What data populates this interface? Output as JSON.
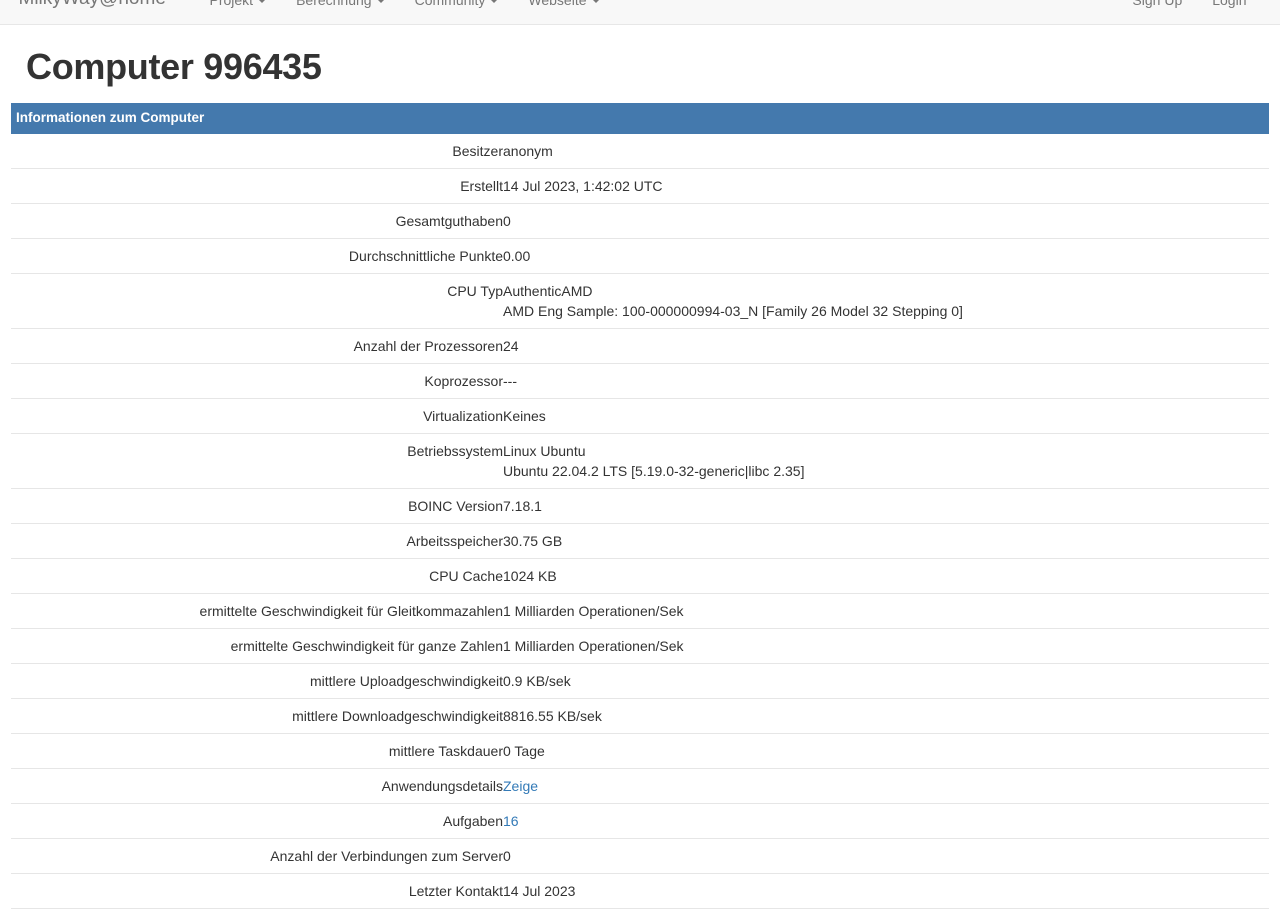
{
  "navbar": {
    "brand": "MilkyWay@home",
    "items": [
      {
        "label": "Projekt",
        "icon": "chevron-down-icon"
      },
      {
        "label": "Berechnung",
        "icon": "chevron-down-icon"
      },
      {
        "label": "Community",
        "icon": "chevron-down-icon"
      },
      {
        "label": "Webseite",
        "icon": "chevron-down-icon"
      }
    ],
    "right": [
      {
        "label": "Sign Up"
      },
      {
        "label": "Login"
      }
    ]
  },
  "page": {
    "title": "Computer 996435",
    "panel_heading": "Informationen zum Computer"
  },
  "colors": {
    "panel_heading_bg": "#4479ad",
    "link": "#337ab7",
    "row_border": "#e6e6e6",
    "navbar_bg": "#f8f8f8",
    "text": "#333333",
    "nav_text": "#777777"
  },
  "rows": [
    {
      "key": "Besitzer",
      "value": "anonym"
    },
    {
      "key": "Erstellt",
      "value": "14 Jul 2023, 1:42:02 UTC"
    },
    {
      "key": "Gesamtguthaben",
      "value": "0"
    },
    {
      "key": "Durchschnittliche Punkte",
      "value": "0.00"
    },
    {
      "key": "CPU Typ",
      "value": "AuthenticAMD",
      "value2": "AMD Eng Sample: 100-000000994-03_N [Family 26 Model 32 Stepping 0]"
    },
    {
      "key": "Anzahl der Prozessoren",
      "value": "24"
    },
    {
      "key": "Koprozessor",
      "value": "---"
    },
    {
      "key": "Virtualization",
      "value": "Keines"
    },
    {
      "key": "Betriebssystem",
      "value": "Linux Ubuntu",
      "value2": "Ubuntu 22.04.2 LTS [5.19.0-32-generic|libc 2.35]"
    },
    {
      "key": "BOINC Version",
      "value": "7.18.1"
    },
    {
      "key": "Arbeitsspeicher",
      "value": "30.75 GB"
    },
    {
      "key": "CPU Cache",
      "value": "1024 KB"
    },
    {
      "key": "ermittelte Geschwindigkeit für Gleitkommazahlen",
      "value": "1 Milliarden Operationen/Sek"
    },
    {
      "key": "ermittelte Geschwindigkeit für ganze Zahlen",
      "value": "1 Milliarden Operationen/Sek"
    },
    {
      "key": "mittlere Uploadgeschwindigkeit",
      "value": "0.9 KB/sek"
    },
    {
      "key": "mittlere Downloadgeschwindigkeit",
      "value": "8816.55 KB/sek"
    },
    {
      "key": "mittlere Taskdauer",
      "value": "0 Tage"
    },
    {
      "key": "Anwendungsdetails",
      "value": "Zeige",
      "link": true
    },
    {
      "key": "Aufgaben",
      "value": "16",
      "link": true
    },
    {
      "key": "Anzahl der Verbindungen zum Server",
      "value": "0"
    },
    {
      "key": "Letzter Kontakt",
      "value": "14 Jul 2023"
    }
  ]
}
